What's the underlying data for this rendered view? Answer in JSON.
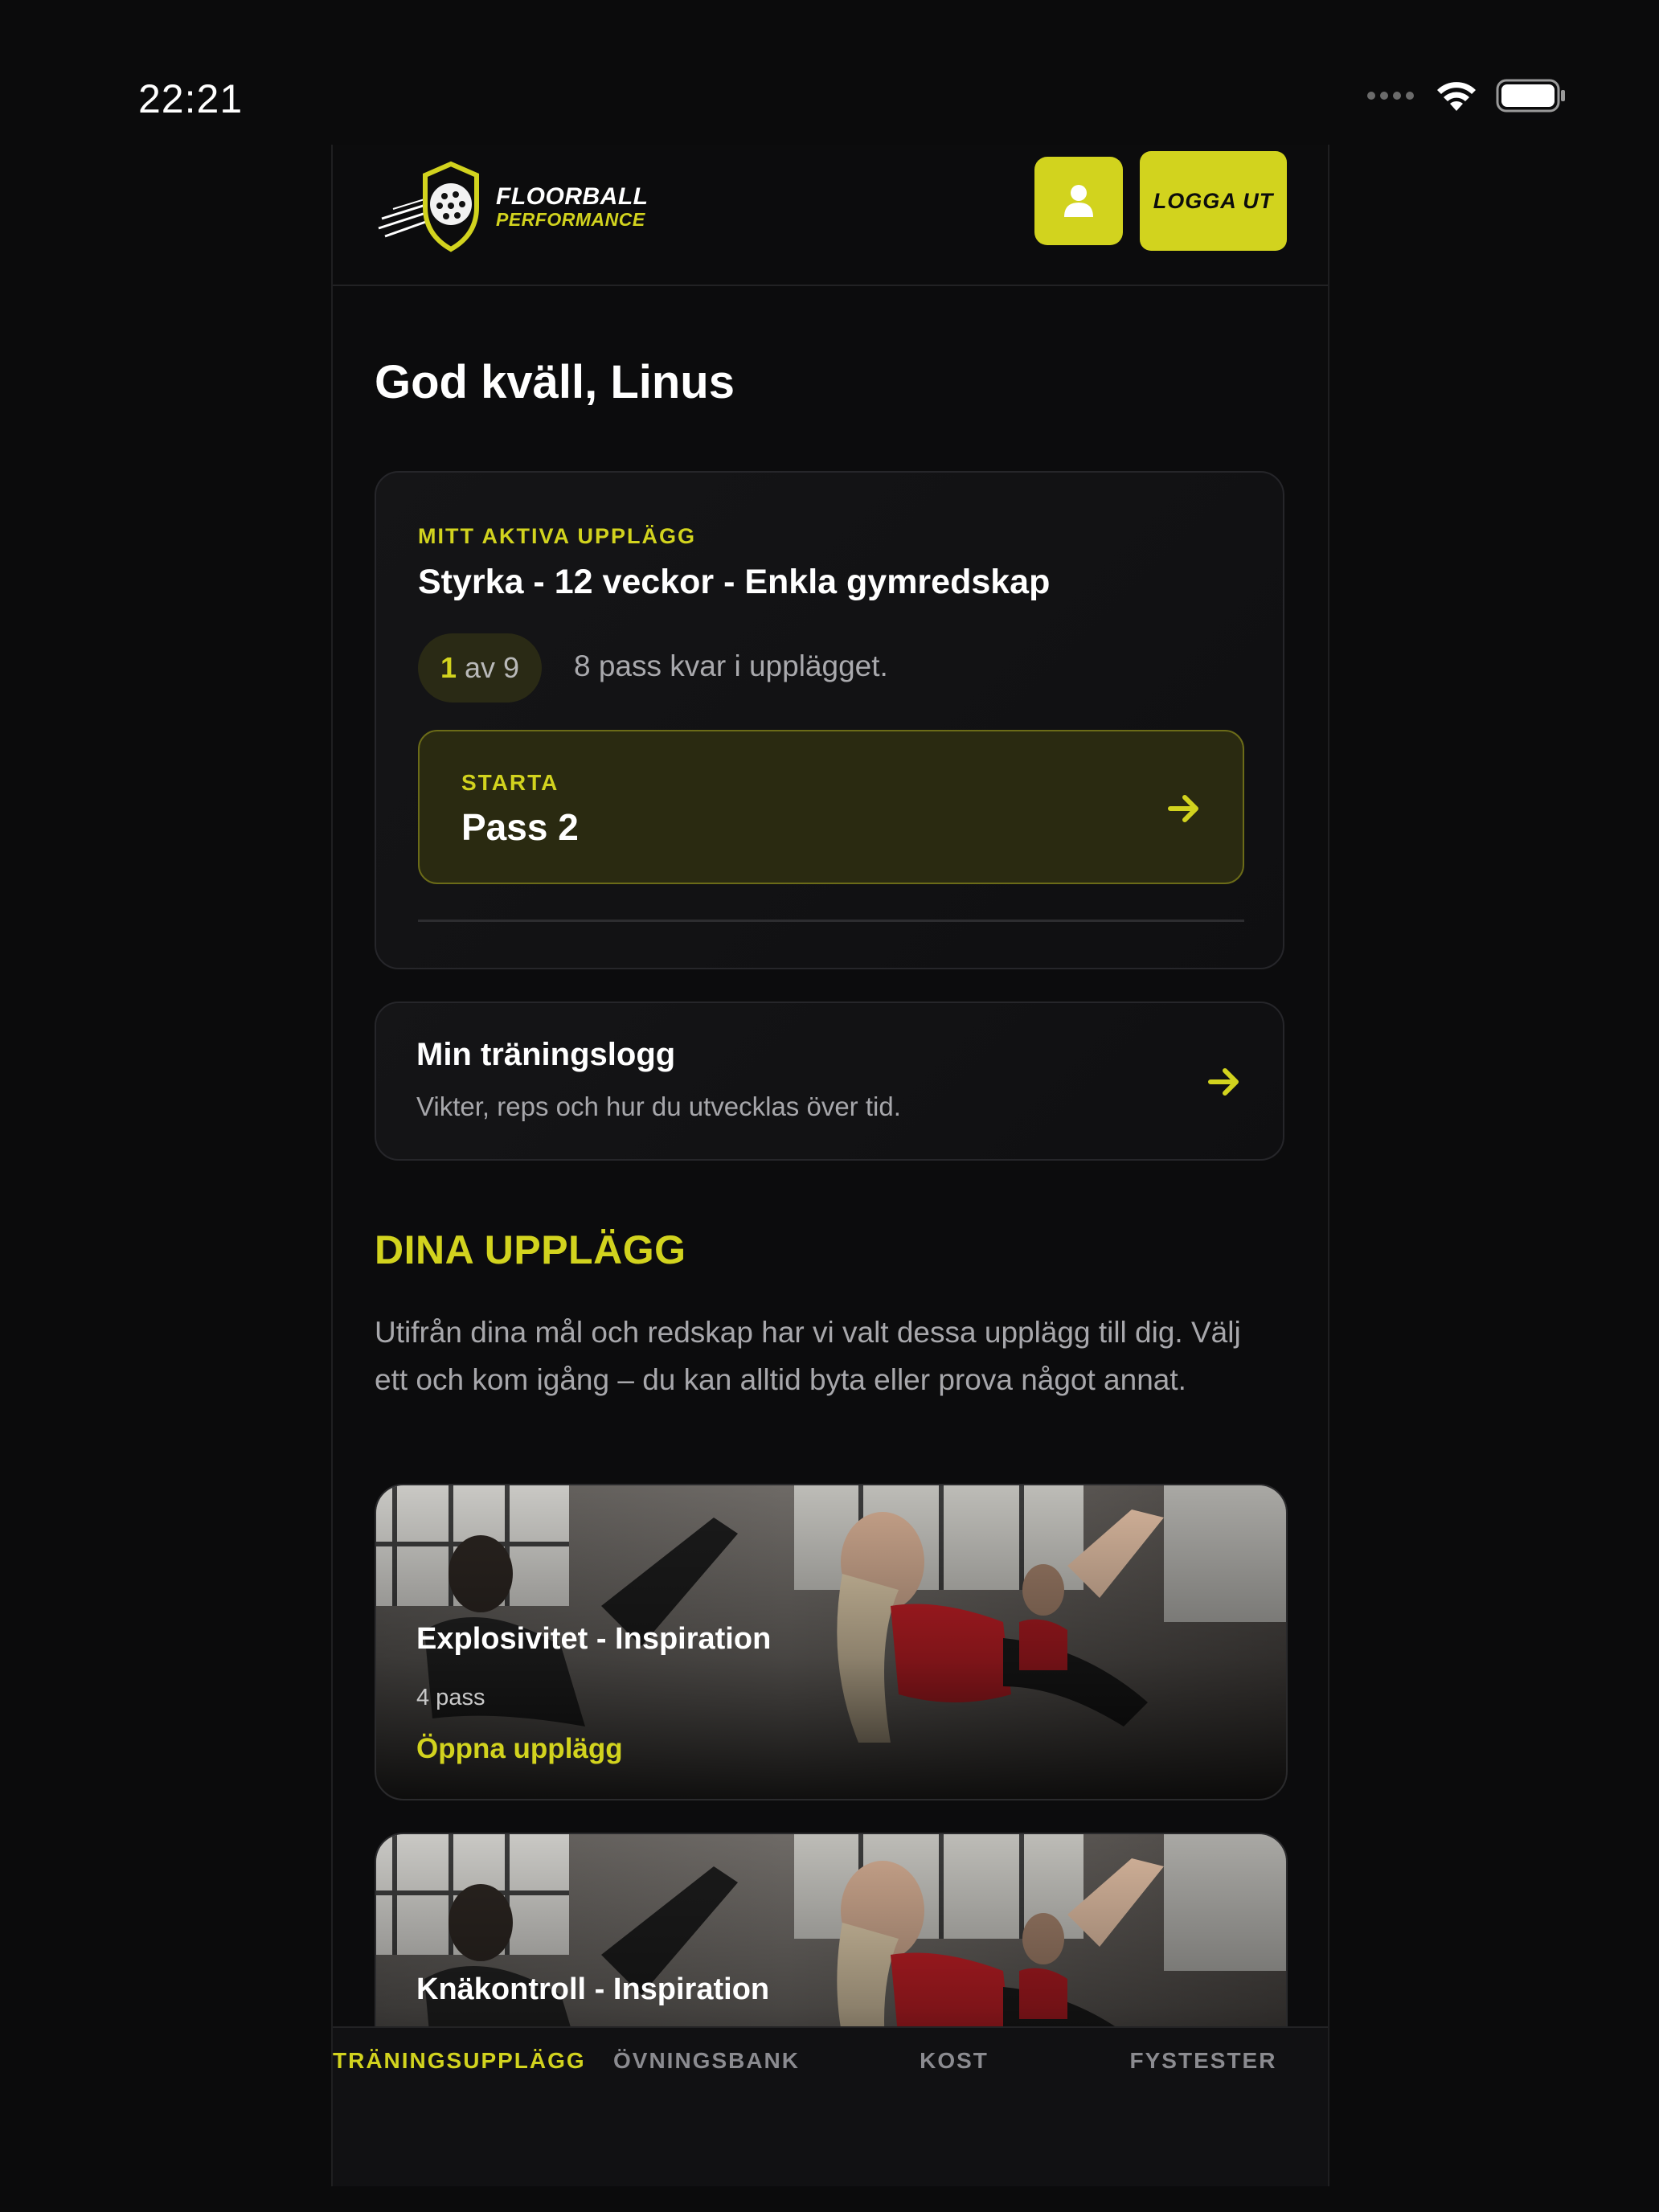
{
  "status": {
    "time": "22:21"
  },
  "brand": {
    "line1": "FLOORBALL",
    "line2": "PERFORMANCE"
  },
  "header": {
    "logout_label": "LOGGA UT"
  },
  "greeting": "God kväll, Linus",
  "active_plan": {
    "eyebrow": "MITT AKTIVA UPPLÄGG",
    "title": "Styrka - 12 veckor - Enkla gymredskap",
    "progress_current": "1",
    "progress_rest": "av 9",
    "remaining_text": "8 pass kvar i upplägget.",
    "start": {
      "eyebrow": "STARTA",
      "title": "Pass 2"
    }
  },
  "log_card": {
    "title": "Min träningslogg",
    "subtitle": "Vikter, reps och hur du utvecklas över tid."
  },
  "plans_section": {
    "title": "DINA UPPLÄGG",
    "description": "Utifrån dina mål och redskap har vi valt dessa upplägg till dig. Välj ett och kom igång – du kan alltid byta eller prova något annat.",
    "cards": [
      {
        "title": "Explosivitet - Inspiration",
        "meta": "4 pass",
        "link": "Öppna upplägg"
      },
      {
        "title": "Knäkontroll - Inspiration"
      }
    ]
  },
  "nav": {
    "items": [
      "TRÄNINGSUPPLÄGG",
      "ÖVNINGSBANK",
      "KOST",
      "FYSTESTER"
    ],
    "active_index": 0
  },
  "colors": {
    "accent": "#d2d31e",
    "background": "#0b0b0c"
  }
}
